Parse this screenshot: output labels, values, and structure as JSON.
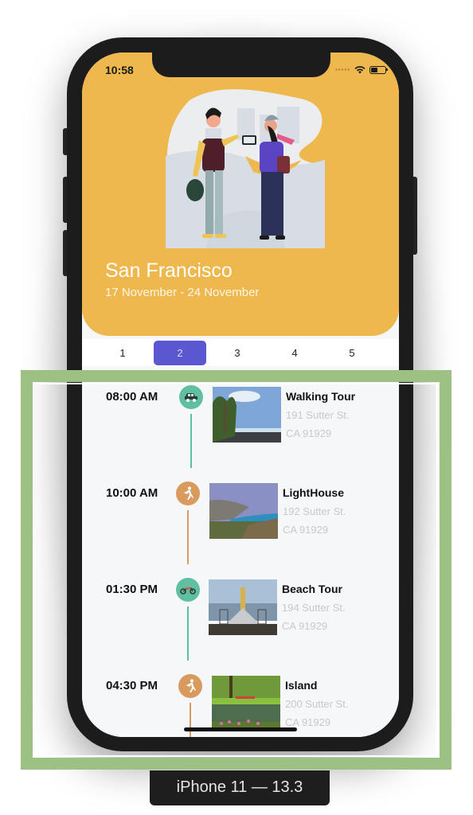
{
  "status_bar": {
    "time": "10:58",
    "icons": [
      "signal-dots-icon",
      "wifi-icon",
      "battery-icon"
    ]
  },
  "header": {
    "illustration": "travelers-illustration",
    "city": "San Francisco",
    "dates": "17 November - 24 November",
    "background_color": "#eeb84e"
  },
  "day_tabs": {
    "items": [
      {
        "label": "1",
        "active": false
      },
      {
        "label": "2",
        "active": true
      },
      {
        "label": "3",
        "active": false
      },
      {
        "label": "4",
        "active": false
      },
      {
        "label": "5",
        "active": false
      }
    ],
    "active_color": "#5b57d1"
  },
  "timeline": {
    "events": [
      {
        "time": "08:00 AM",
        "icon": "car-icon",
        "color": "#5fbfa0",
        "title": "Walking Tour",
        "address_line1": "191 Sutter St.",
        "address_line2": "CA 91929",
        "photo": "palm-beach-photo"
      },
      {
        "time": "10:00 AM",
        "icon": "walking-person-icon",
        "color": "#d99a5e",
        "title": "LightHouse",
        "address_line1": "192 Sutter St.",
        "address_line2": "CA 91929",
        "photo": "coastal-cliff-photo"
      },
      {
        "time": "01:30 PM",
        "icon": "motorcycle-icon",
        "color": "#5fbfa0",
        "title": "Beach Tour",
        "address_line1": "194 Sutter St.",
        "address_line2": "CA 91929",
        "photo": "pier-lighthouse-photo"
      },
      {
        "time": "04:30 PM",
        "icon": "walking-person-icon",
        "color": "#d99a5e",
        "title": "Island",
        "address_line1": "200 Sutter St.",
        "address_line2": "CA 91929",
        "photo": "park-lake-photo"
      }
    ]
  },
  "device_label": "iPhone 11 — 13.3",
  "highlight_color": "#9dc183"
}
